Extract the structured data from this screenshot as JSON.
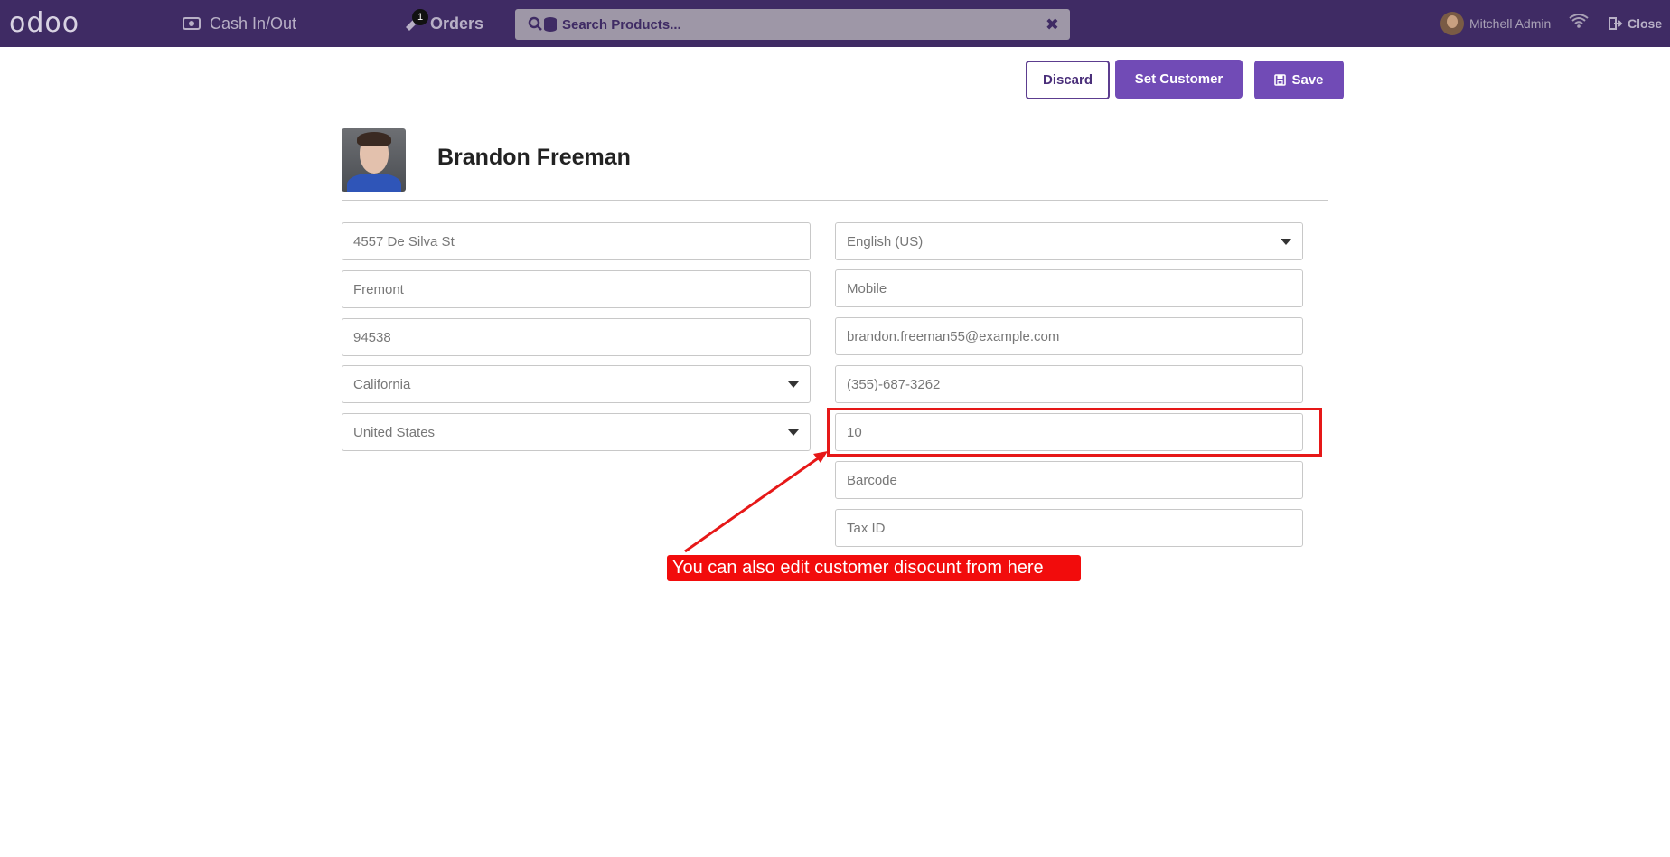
{
  "topbar": {
    "logo": "odoo",
    "cash_label": "Cash In/Out",
    "orders_label": "Orders",
    "orders_count": "1",
    "search_placeholder": "Search Products...",
    "search_clear": "✖",
    "user_name": "Mitchell Admin",
    "close_label": "Close"
  },
  "toolbar": {
    "discard_label": "Discard",
    "set_customer_label": "Set Customer",
    "save_label": "Save"
  },
  "customer": {
    "name": "Brandon Freeman"
  },
  "fields_left": {
    "street": "4557 De Silva St",
    "city": "Fremont",
    "zip": "94538",
    "state": "California",
    "country": "United States"
  },
  "fields_right": {
    "language": "English (US)",
    "mobile_placeholder": "Mobile",
    "email": "brandon.freeman55@example.com",
    "phone": "(355)-687-3262",
    "discount": "10",
    "barcode_placeholder": "Barcode",
    "tax_id_placeholder": "Tax ID"
  },
  "annotation": {
    "text": "You can also edit customer disocunt from here"
  },
  "colors": {
    "topbar": "#3f2b64",
    "primary": "#714bb6",
    "highlight": "#e61818"
  }
}
